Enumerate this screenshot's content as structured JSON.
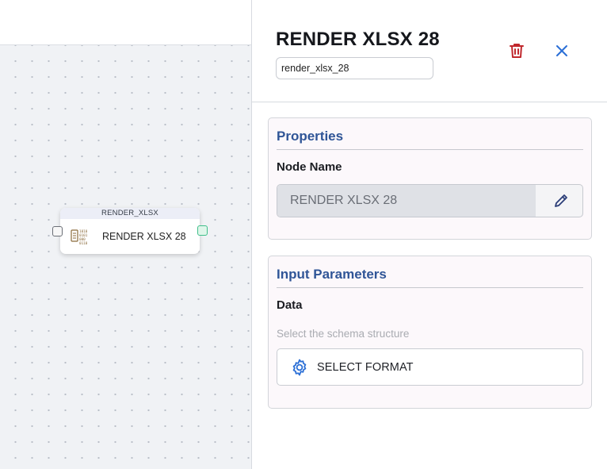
{
  "canvas": {
    "node": {
      "type_label": "RENDER_XLSX",
      "label": "RENDER XLSX 28",
      "icon": "binary-document-icon"
    }
  },
  "panel": {
    "title": "RENDER XLSX 28",
    "node_id": "render_xlsx_28",
    "delete_icon": "trash-icon",
    "close_icon": "close-icon",
    "properties": {
      "title": "Properties",
      "node_name_label": "Node Name",
      "node_name_value": "RENDER XLSX 28",
      "edit_icon": "pencil-icon"
    },
    "input_parameters": {
      "title": "Input Parameters",
      "data_label": "Data",
      "hint": "Select the schema structure",
      "select_button": "SELECT FORMAT",
      "select_icon": "gear-icon"
    }
  },
  "colors": {
    "accent_blue": "#2f5597",
    "delete_red": "#c0282d",
    "close_blue": "#2b6fd6",
    "port_green": "#3fbf8a"
  }
}
